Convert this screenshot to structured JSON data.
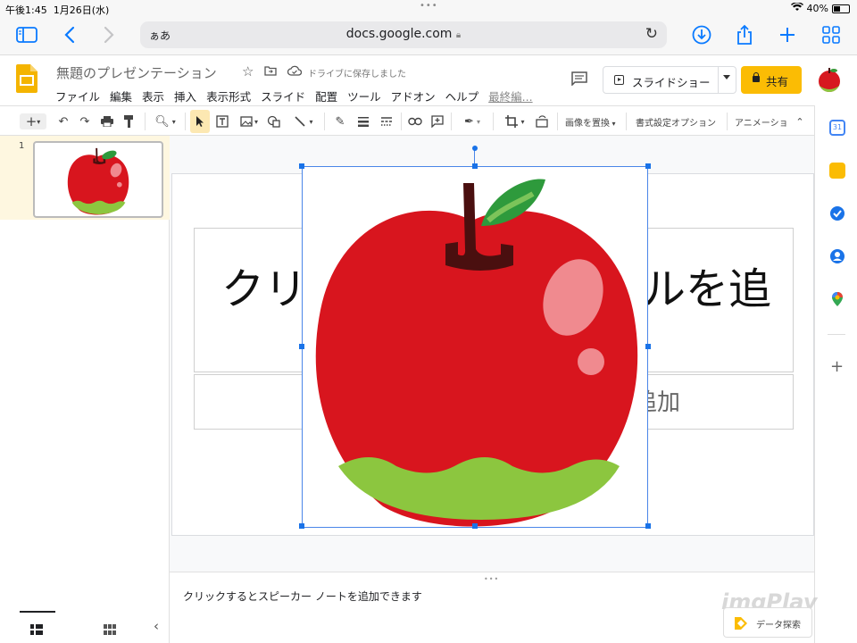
{
  "status_bar": {
    "time": "午後1:45",
    "date": "1月26日(水)",
    "battery": "40%",
    "dots": "•••"
  },
  "browser": {
    "text_size": "ぁあ",
    "url": "docs.google.com",
    "icons": [
      "sidebar-icon",
      "back-icon",
      "forward-icon",
      "reload-icon",
      "download-icon",
      "share-icon",
      "new-tab-icon",
      "tabs-icon"
    ],
    "accent": "#0a7aff"
  },
  "app": {
    "title": "無題のプレゼンテーション",
    "saved_status": "ドライブに保存しました",
    "menu": [
      "ファイル",
      "編集",
      "表示",
      "挿入",
      "表示形式",
      "スライド",
      "配置",
      "ツール",
      "アドオン",
      "ヘルプ",
      "最終編..."
    ],
    "slideshow_label": "スライドショー",
    "share_label": "共有",
    "share_color": "#fbbc04"
  },
  "toolbar": {
    "replace_image": "画像を置換",
    "format_options": "書式設定オプション",
    "animation": "アニメーショ"
  },
  "filmstrip": {
    "slide_number": "1"
  },
  "slide": {
    "title_left": "クリ",
    "title_right": "ルを追",
    "subtitle_right": "追加"
  },
  "notes": {
    "placeholder": "クリックするとスピーカー ノートを追加できます"
  },
  "explore": {
    "label": "データ探索"
  },
  "watermark": "imgPlay"
}
